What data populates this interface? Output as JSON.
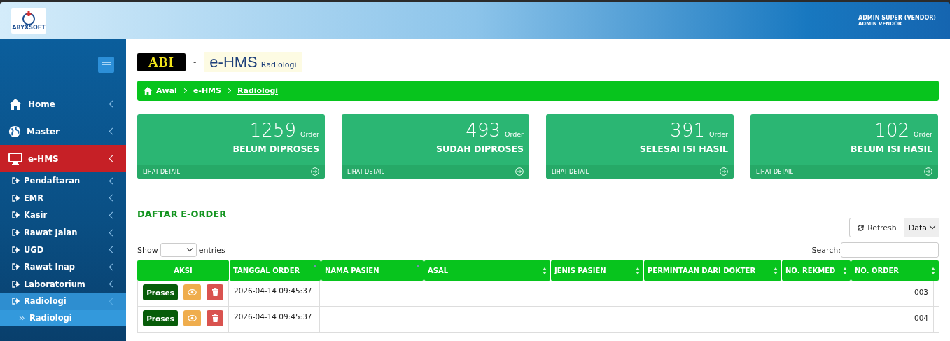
{
  "header": {
    "logo_text": "ABYXSOFT",
    "user_name": "ADMIN SUPER (VENDOR)",
    "user_role": "ADMIN VENDOR"
  },
  "sidebar": {
    "items": [
      {
        "label": "Home",
        "selected": false,
        "expanded": false
      },
      {
        "label": "Master",
        "selected": false,
        "expanded": false
      },
      {
        "label": "e-HMS",
        "selected": true,
        "expanded": true,
        "children": [
          {
            "label": "Pendaftaran",
            "selected": false,
            "expanded": false
          },
          {
            "label": "EMR",
            "selected": false,
            "expanded": false
          },
          {
            "label": "Kasir",
            "selected": false,
            "expanded": false
          },
          {
            "label": "Rawat Jalan",
            "selected": false,
            "expanded": false
          },
          {
            "label": "UGD",
            "selected": false,
            "expanded": false
          },
          {
            "label": "Rawat Inap",
            "selected": false,
            "expanded": false
          },
          {
            "label": "Laboratorium",
            "selected": false,
            "expanded": false
          },
          {
            "label": "Radiologi",
            "selected": true,
            "expanded": true,
            "children": [
              {
                "label": "Radiologi",
                "selected": true
              }
            ]
          }
        ]
      }
    ]
  },
  "title": {
    "badge": "ABI",
    "separator": "-",
    "app": "e-HMS",
    "module": "Radiologi"
  },
  "breadcrumb": [
    "Awal",
    "e-HMS",
    "Radiologi"
  ],
  "stats": [
    {
      "count": "1259",
      "unit": "Order",
      "label": "BELUM DIPROSES",
      "link": "LIHAT DETAIL"
    },
    {
      "count": "493",
      "unit": "Order",
      "label": "SUDAH DIPROSES",
      "link": "LIHAT DETAIL"
    },
    {
      "count": "391",
      "unit": "Order",
      "label": "SELESAI ISI HASIL",
      "link": "LIHAT DETAIL"
    },
    {
      "count": "102",
      "unit": "Order",
      "label": "BELUM ISI HASIL",
      "link": "LIHAT DETAIL"
    }
  ],
  "section_title": "DAFTAR E-ORDER",
  "toolbar": {
    "refresh": "Refresh",
    "data": "Data"
  },
  "table_controls": {
    "show": "Show",
    "entries": "entries",
    "search": "Search:"
  },
  "table": {
    "columns": [
      {
        "label": "AKSI",
        "kind": "plain"
      },
      {
        "label": "TANGGAL ORDER",
        "kind": "sorted"
      },
      {
        "label": "NAMA PASIEN",
        "kind": "sorted"
      },
      {
        "label": "ASAL",
        "kind": "sortable"
      },
      {
        "label": "JENIS PASIEN",
        "kind": "sortable"
      },
      {
        "label": "PERMINTAAN DARI DOKTER",
        "kind": "sortable"
      },
      {
        "label": "NO. REKMED",
        "kind": "sortable"
      },
      {
        "label": "NO. ORDER",
        "kind": "sortable"
      }
    ],
    "rows": [
      {
        "action": "Proses",
        "date": "2026-04-14 09:45:37",
        "order_no": "003"
      },
      {
        "action": "Proses",
        "date": "2026-04-14 09:45:37",
        "order_no": "004"
      }
    ]
  }
}
